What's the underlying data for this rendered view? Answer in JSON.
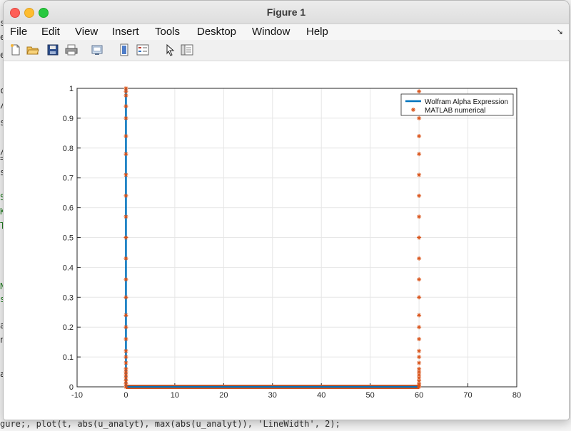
{
  "window": {
    "title": "Figure 1"
  },
  "menu": [
    "File",
    "Edit",
    "View",
    "Insert",
    "Tools",
    "Desktop",
    "Window",
    "Help"
  ],
  "toolbar": [
    "new-figure-icon",
    "open-icon",
    "save-icon",
    "print-icon",
    "export-icon",
    "colorbar-icon",
    "legend-icon",
    "pointer-icon",
    "property-inspector-icon"
  ],
  "background": {
    "chars": [
      {
        "c": "s",
        "g": false
      },
      {
        "c": "e",
        "g": false
      },
      {
        "c": "e",
        "g": false
      },
      {
        "c": "c",
        "g": false
      },
      {
        "c": "/",
        "g": false
      },
      {
        "c": "s",
        "g": false
      },
      {
        "c": "/",
        "g": false
      },
      {
        "c": "=",
        "g": false
      },
      {
        "c": "s",
        "g": false
      },
      {
        "c": "S",
        "g": true
      },
      {
        "c": "K",
        "g": true
      },
      {
        "c": "T",
        "g": true
      },
      {
        "c": "N",
        "g": true
      },
      {
        "c": "s",
        "g": true
      },
      {
        "c": "a",
        "g": false
      },
      {
        "c": "n",
        "g": false
      },
      {
        "c": "a",
        "g": false
      }
    ],
    "bottom_text": "gure;, plot(t, abs(u_analyt), max(abs(u_analyt)), 'LineWidth', 2);"
  },
  "chart_data": {
    "type": "line",
    "xlim": [
      -10,
      80
    ],
    "ylim": [
      0,
      1
    ],
    "xticks": [
      -10,
      0,
      10,
      20,
      30,
      40,
      50,
      60,
      70,
      80
    ],
    "yticks": [
      0,
      0.1,
      0.2,
      0.3,
      0.4,
      0.5,
      0.6,
      0.7,
      0.8,
      0.9,
      1
    ],
    "grid": true,
    "legend_position": "top-right",
    "series": [
      {
        "name": "Wolfram Alpha Expression",
        "style": "line",
        "color": "#0072bd",
        "x": [
          0,
          0,
          0.15,
          60
        ],
        "y": [
          1,
          0,
          0,
          0
        ]
      },
      {
        "name": "MATLAB numerical",
        "style": "marker-asterisk",
        "color": "#d95319",
        "x_at_zero": [
          0,
          0,
          0,
          0,
          0,
          0,
          0,
          0,
          0,
          0,
          0,
          0,
          0,
          0,
          0,
          0,
          0,
          0,
          0,
          0,
          0,
          0,
          0,
          0,
          0,
          0,
          0
        ],
        "y_at_zero": [
          1,
          0.99,
          0.976,
          0.94,
          0.9,
          0.84,
          0.78,
          0.71,
          0.64,
          0.57,
          0.5,
          0.43,
          0.36,
          0.3,
          0.24,
          0.2,
          0.16,
          0.12,
          0.1,
          0.08,
          0.06,
          0.05,
          0.04,
          0.03,
          0.02,
          0.01,
          0
        ],
        "x_at_sixty": [
          60,
          60,
          60,
          60,
          60,
          60,
          60,
          60,
          60,
          60,
          60,
          60,
          60,
          60,
          60,
          60,
          60,
          60,
          60,
          60,
          60,
          60,
          60,
          60,
          60,
          60
        ],
        "y_at_sixty": [
          0.99,
          0.94,
          0.9,
          0.84,
          0.78,
          0.71,
          0.64,
          0.57,
          0.5,
          0.43,
          0.36,
          0.3,
          0.24,
          0.2,
          0.16,
          0.12,
          0.1,
          0.08,
          0.06,
          0.05,
          0.04,
          0.03,
          0.02,
          0.01,
          0.005,
          0
        ],
        "baseline_x_range": [
          0,
          60
        ],
        "baseline_y": 0
      }
    ]
  }
}
